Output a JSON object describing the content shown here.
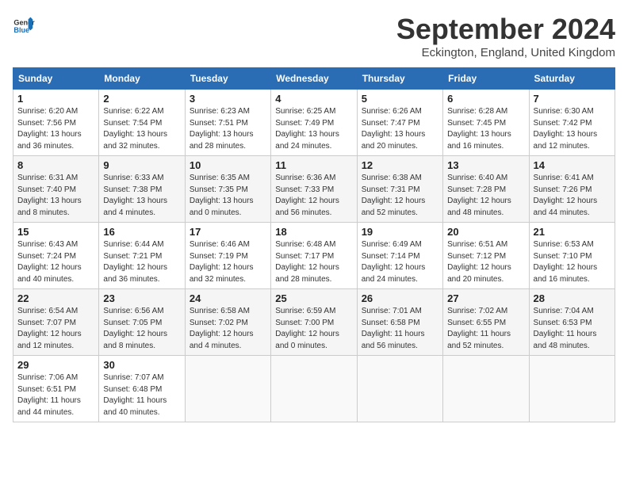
{
  "logo": {
    "line1": "General",
    "line2": "Blue"
  },
  "title": "September 2024",
  "location": "Eckington, England, United Kingdom",
  "weekdays": [
    "Sunday",
    "Monday",
    "Tuesday",
    "Wednesday",
    "Thursday",
    "Friday",
    "Saturday"
  ],
  "weeks": [
    [
      {
        "day": "1",
        "sunrise": "Sunrise: 6:20 AM",
        "sunset": "Sunset: 7:56 PM",
        "daylight": "Daylight: 13 hours and 36 minutes."
      },
      {
        "day": "2",
        "sunrise": "Sunrise: 6:22 AM",
        "sunset": "Sunset: 7:54 PM",
        "daylight": "Daylight: 13 hours and 32 minutes."
      },
      {
        "day": "3",
        "sunrise": "Sunrise: 6:23 AM",
        "sunset": "Sunset: 7:51 PM",
        "daylight": "Daylight: 13 hours and 28 minutes."
      },
      {
        "day": "4",
        "sunrise": "Sunrise: 6:25 AM",
        "sunset": "Sunset: 7:49 PM",
        "daylight": "Daylight: 13 hours and 24 minutes."
      },
      {
        "day": "5",
        "sunrise": "Sunrise: 6:26 AM",
        "sunset": "Sunset: 7:47 PM",
        "daylight": "Daylight: 13 hours and 20 minutes."
      },
      {
        "day": "6",
        "sunrise": "Sunrise: 6:28 AM",
        "sunset": "Sunset: 7:45 PM",
        "daylight": "Daylight: 13 hours and 16 minutes."
      },
      {
        "day": "7",
        "sunrise": "Sunrise: 6:30 AM",
        "sunset": "Sunset: 7:42 PM",
        "daylight": "Daylight: 13 hours and 12 minutes."
      }
    ],
    [
      {
        "day": "8",
        "sunrise": "Sunrise: 6:31 AM",
        "sunset": "Sunset: 7:40 PM",
        "daylight": "Daylight: 13 hours and 8 minutes."
      },
      {
        "day": "9",
        "sunrise": "Sunrise: 6:33 AM",
        "sunset": "Sunset: 7:38 PM",
        "daylight": "Daylight: 13 hours and 4 minutes."
      },
      {
        "day": "10",
        "sunrise": "Sunrise: 6:35 AM",
        "sunset": "Sunset: 7:35 PM",
        "daylight": "Daylight: 13 hours and 0 minutes."
      },
      {
        "day": "11",
        "sunrise": "Sunrise: 6:36 AM",
        "sunset": "Sunset: 7:33 PM",
        "daylight": "Daylight: 12 hours and 56 minutes."
      },
      {
        "day": "12",
        "sunrise": "Sunrise: 6:38 AM",
        "sunset": "Sunset: 7:31 PM",
        "daylight": "Daylight: 12 hours and 52 minutes."
      },
      {
        "day": "13",
        "sunrise": "Sunrise: 6:40 AM",
        "sunset": "Sunset: 7:28 PM",
        "daylight": "Daylight: 12 hours and 48 minutes."
      },
      {
        "day": "14",
        "sunrise": "Sunrise: 6:41 AM",
        "sunset": "Sunset: 7:26 PM",
        "daylight": "Daylight: 12 hours and 44 minutes."
      }
    ],
    [
      {
        "day": "15",
        "sunrise": "Sunrise: 6:43 AM",
        "sunset": "Sunset: 7:24 PM",
        "daylight": "Daylight: 12 hours and 40 minutes."
      },
      {
        "day": "16",
        "sunrise": "Sunrise: 6:44 AM",
        "sunset": "Sunset: 7:21 PM",
        "daylight": "Daylight: 12 hours and 36 minutes."
      },
      {
        "day": "17",
        "sunrise": "Sunrise: 6:46 AM",
        "sunset": "Sunset: 7:19 PM",
        "daylight": "Daylight: 12 hours and 32 minutes."
      },
      {
        "day": "18",
        "sunrise": "Sunrise: 6:48 AM",
        "sunset": "Sunset: 7:17 PM",
        "daylight": "Daylight: 12 hours and 28 minutes."
      },
      {
        "day": "19",
        "sunrise": "Sunrise: 6:49 AM",
        "sunset": "Sunset: 7:14 PM",
        "daylight": "Daylight: 12 hours and 24 minutes."
      },
      {
        "day": "20",
        "sunrise": "Sunrise: 6:51 AM",
        "sunset": "Sunset: 7:12 PM",
        "daylight": "Daylight: 12 hours and 20 minutes."
      },
      {
        "day": "21",
        "sunrise": "Sunrise: 6:53 AM",
        "sunset": "Sunset: 7:10 PM",
        "daylight": "Daylight: 12 hours and 16 minutes."
      }
    ],
    [
      {
        "day": "22",
        "sunrise": "Sunrise: 6:54 AM",
        "sunset": "Sunset: 7:07 PM",
        "daylight": "Daylight: 12 hours and 12 minutes."
      },
      {
        "day": "23",
        "sunrise": "Sunrise: 6:56 AM",
        "sunset": "Sunset: 7:05 PM",
        "daylight": "Daylight: 12 hours and 8 minutes."
      },
      {
        "day": "24",
        "sunrise": "Sunrise: 6:58 AM",
        "sunset": "Sunset: 7:02 PM",
        "daylight": "Daylight: 12 hours and 4 minutes."
      },
      {
        "day": "25",
        "sunrise": "Sunrise: 6:59 AM",
        "sunset": "Sunset: 7:00 PM",
        "daylight": "Daylight: 12 hours and 0 minutes."
      },
      {
        "day": "26",
        "sunrise": "Sunrise: 7:01 AM",
        "sunset": "Sunset: 6:58 PM",
        "daylight": "Daylight: 11 hours and 56 minutes."
      },
      {
        "day": "27",
        "sunrise": "Sunrise: 7:02 AM",
        "sunset": "Sunset: 6:55 PM",
        "daylight": "Daylight: 11 hours and 52 minutes."
      },
      {
        "day": "28",
        "sunrise": "Sunrise: 7:04 AM",
        "sunset": "Sunset: 6:53 PM",
        "daylight": "Daylight: 11 hours and 48 minutes."
      }
    ],
    [
      {
        "day": "29",
        "sunrise": "Sunrise: 7:06 AM",
        "sunset": "Sunset: 6:51 PM",
        "daylight": "Daylight: 11 hours and 44 minutes."
      },
      {
        "day": "30",
        "sunrise": "Sunrise: 7:07 AM",
        "sunset": "Sunset: 6:48 PM",
        "daylight": "Daylight: 11 hours and 40 minutes."
      },
      null,
      null,
      null,
      null,
      null
    ]
  ]
}
